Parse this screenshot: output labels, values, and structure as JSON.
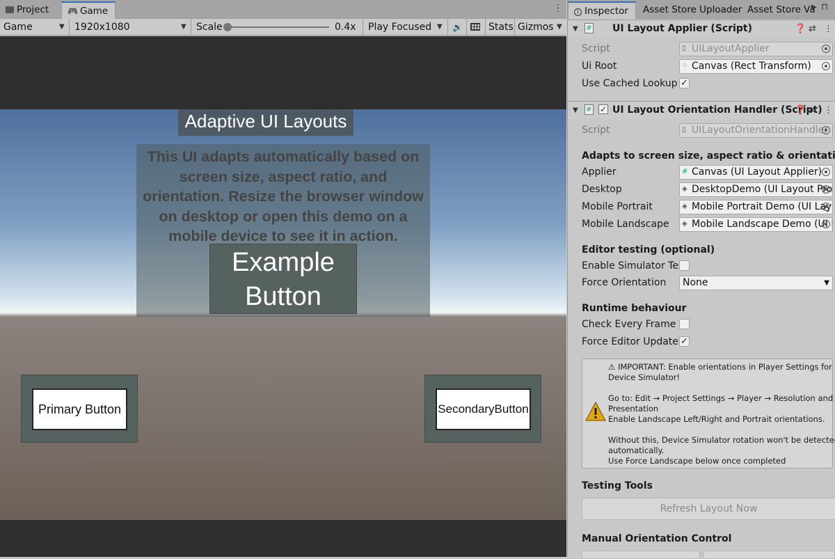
{
  "left_tabs": {
    "project": "Project",
    "game": "Game"
  },
  "toolbar": {
    "display": "Game",
    "resolution": "1920x1080",
    "scale_label": "Scale",
    "scale_value": "0.4x",
    "scale_fraction": 0.0,
    "play_mode": "Play Focused",
    "stats": "Stats",
    "gizmos": "Gizmos"
  },
  "game": {
    "title": "Adaptive UI Layouts",
    "description": "This UI adapts automatically based on screen size, aspect ratio, and orientation. Resize the browser window on desktop or open this demo on a mobile device to see it in action.",
    "example_button_line1": "Example",
    "example_button_line2": "Button",
    "primary_button": "Primary Button",
    "secondary_button": "SecondaryButton"
  },
  "right_tabs": {
    "inspector": "Inspector",
    "uploader": "Asset Store Uploader",
    "validator": "Asset Store Va"
  },
  "comp1": {
    "title": "UI Layout Applier (Script)",
    "script_label": "Script",
    "script_value": "UILayoutApplier",
    "uiroot_label": "Ui Root",
    "uiroot_value": "Canvas (Rect Transform)",
    "cached_label": "Use Cached Lookup",
    "cached_check": "✓"
  },
  "comp2": {
    "title": "UI Layout Orientation Handler (Script)",
    "enabled_check": "✓",
    "script_label": "Script",
    "script_value": "UILayoutOrientationHandler",
    "adapts_header": "Adapts to screen size, aspect ratio & orientation — Deskto",
    "applier_label": "Applier",
    "applier_value": "Canvas (UI Layout Applier)",
    "desktop_label": "Desktop",
    "desktop_value": "DesktopDemo (UI Layout Profil",
    "mobile_portrait_label": "Mobile Portrait",
    "mobile_portrait_value": "Mobile Portrait Demo (UI Layou",
    "mobile_landscape_label": "Mobile Landscape",
    "mobile_landscape_value": "Mobile Landscape Demo (UI La",
    "editor_testing_header": "Editor testing (optional)",
    "sim_label": "Enable Simulator Testir",
    "force_orient_label": "Force Orientation",
    "force_orient_value": "None",
    "runtime_header": "Runtime behaviour",
    "check_every_frame_label": "Check Every Frame",
    "force_editor_update_label": "Force Editor Update",
    "force_editor_update_check": "✓",
    "warning_line1": "⚠ IMPORTANT: Enable orientations in Player Settings for",
    "warning_line2": "Device Simulator!",
    "warning_line3": "Go to: Edit → Project Settings → Player → Resolution and",
    "warning_line4": "Presentation",
    "warning_line5": "Enable Landscape Left/Right and Portrait orientations.",
    "warning_line6": "Without this, Device Simulator rotation won't be detected",
    "warning_line7": "automatically.",
    "warning_line8": "Use Force Landscape below once completed",
    "testing_tools_header": "Testing Tools",
    "refresh_button": "Refresh Layout Now",
    "manual_header": "Manual Orientation Control"
  }
}
